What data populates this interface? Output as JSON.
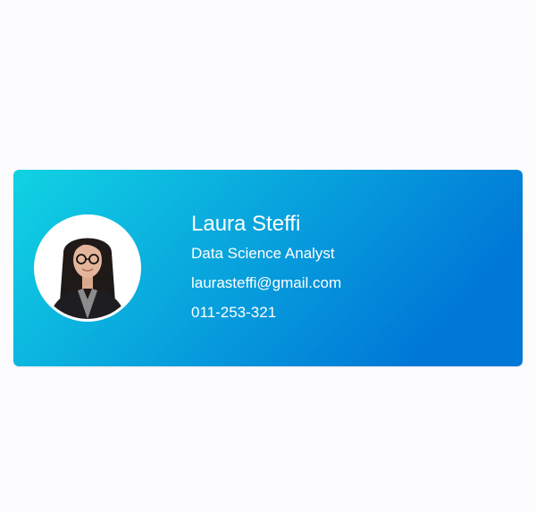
{
  "profile": {
    "name": "Laura Steffi",
    "title": "Data Science Analyst",
    "email": "laurasteffi@gmail.com",
    "phone": "011-253-321",
    "avatar_icon": "person-photo"
  },
  "theme": {
    "gradient_start": "#11d3e3",
    "gradient_end": "#0078d7",
    "text_color": "#ffffff",
    "background": "#fcfbfd"
  }
}
